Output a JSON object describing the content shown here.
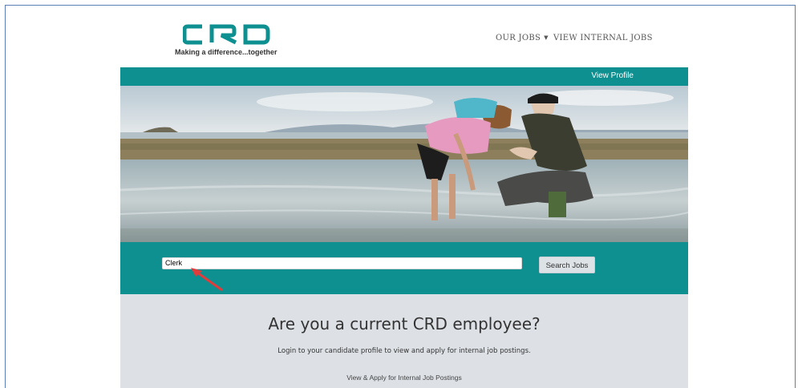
{
  "header": {
    "logo_text": "CRD",
    "tagline": "Making a difference...together",
    "nav": {
      "our_jobs": "OUR JOBS",
      "view_internal_jobs": "VIEW INTERNAL JOBS"
    }
  },
  "topbar": {
    "view_profile": "View Profile"
  },
  "search": {
    "value": "Clerk",
    "button_label": "Search Jobs"
  },
  "employee_section": {
    "heading": "Are you a current CRD employee?",
    "description": "Login to your candidate profile to view and apply for internal job postings.",
    "link": "View & Apply for Internal Job Postings"
  },
  "colors": {
    "teal": "#0e8f90",
    "panel_gray": "#dde1e6",
    "annotation_arrow": "#e23b3b"
  }
}
